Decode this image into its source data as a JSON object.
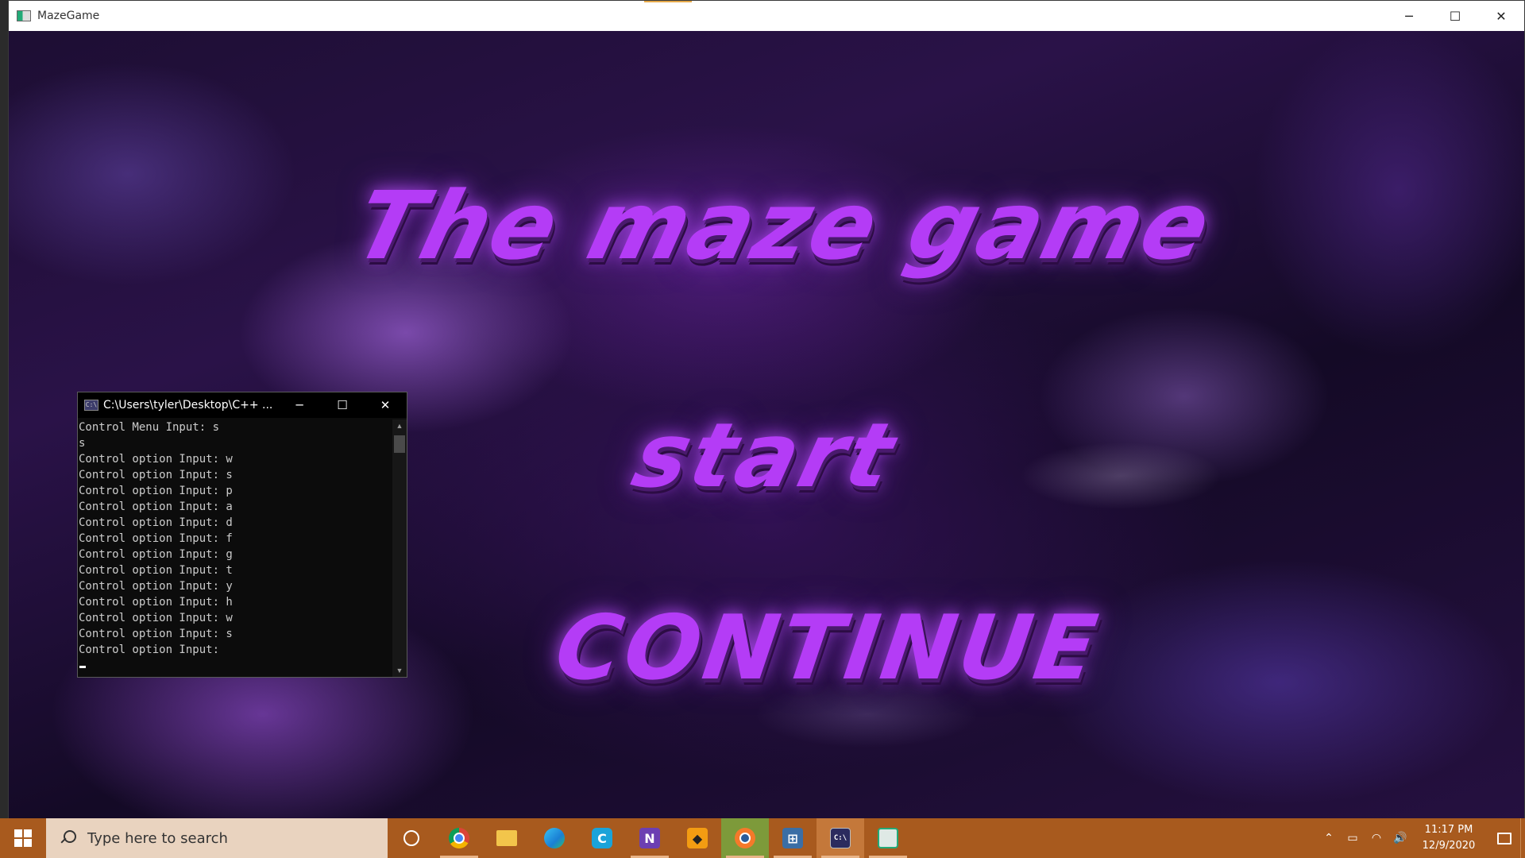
{
  "game_window": {
    "title": "MazeGame",
    "minimize_glyph": "─",
    "maximize_glyph": "☐",
    "close_glyph": "✕"
  },
  "game_menu": {
    "title": "The maze game",
    "start_label": "Start",
    "continue_label": "CONTINUE"
  },
  "console": {
    "title": "C:\\Users\\tyler\\Desktop\\C++ ...",
    "icon_text": "C:\\",
    "minimize_glyph": "─",
    "maximize_glyph": "☐",
    "close_glyph": "✕",
    "lines": [
      "Control Menu Input: s",
      "s",
      "Control option Input: w",
      "Control option Input: s",
      "Control option Input: p",
      "Control option Input: a",
      "Control option Input: d",
      "Control option Input: f",
      "Control option Input: g",
      "Control option Input: t",
      "Control option Input: y",
      "Control option Input: h",
      "Control option Input: w",
      "Control option Input: s",
      "Control option Input:"
    ]
  },
  "taskbar": {
    "search_placeholder": "Type here to search",
    "apps": [
      {
        "name": "Cortana",
        "icon": "cortana-icon"
      },
      {
        "name": "Google Chrome",
        "icon": "chrome-icon"
      },
      {
        "name": "File Explorer",
        "icon": "folder-icon"
      },
      {
        "name": "Microsoft Edge",
        "icon": "edge-icon"
      },
      {
        "name": "CCleaner",
        "icon": "ccleaner-icon",
        "glyph": "C"
      },
      {
        "name": "Visual Studio",
        "icon": "visual-studio-icon",
        "glyph": "N"
      },
      {
        "name": "Sublime Text",
        "icon": "sublime-icon",
        "glyph": "◆"
      },
      {
        "name": "Blender",
        "icon": "blender-icon"
      },
      {
        "name": "Network app",
        "icon": "network-icon",
        "glyph": "⊞"
      },
      {
        "name": "Console",
        "icon": "console-icon",
        "glyph": "C:\\"
      },
      {
        "name": "MazeGame",
        "icon": "mazegame-icon"
      }
    ],
    "tray": {
      "chevron": "⌃",
      "battery": "▭",
      "wifi": "◠",
      "volume": "🔊"
    },
    "clock_time": "11:17 PM",
    "clock_date": "12/9/2020"
  },
  "colors": {
    "taskbar": "#a85a1e",
    "game_text": "#b43cf6",
    "console_bg": "#0c0c0c"
  }
}
